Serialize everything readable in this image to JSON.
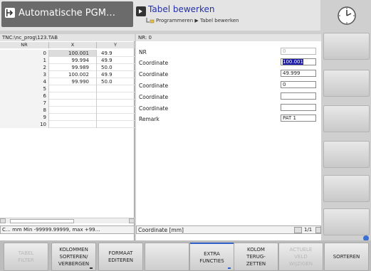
{
  "header": {
    "mode_title": "Automatische PGM…",
    "program_title": "Tabel bewerken",
    "breadcrumb": "Programmeren ▶ Tabel bewerken"
  },
  "table": {
    "path": "TNC:\\nc_prog\\123.TAB",
    "columns": [
      "NR",
      "X",
      "Y"
    ],
    "rows": [
      {
        "nr": "0",
        "x": "100.001",
        "y": "49.9"
      },
      {
        "nr": "1",
        "x": "99.994",
        "y": "49.9"
      },
      {
        "nr": "2",
        "x": "99.989",
        "y": "50.0"
      },
      {
        "nr": "3",
        "x": "100.002",
        "y": "49.9"
      },
      {
        "nr": "4",
        "x": "99.990",
        "y": "50.0"
      },
      {
        "nr": "5",
        "x": "",
        "y": ""
      },
      {
        "nr": "6",
        "x": "",
        "y": ""
      },
      {
        "nr": "7",
        "x": "",
        "y": ""
      },
      {
        "nr": "8",
        "x": "",
        "y": ""
      },
      {
        "nr": "9",
        "x": "",
        "y": ""
      },
      {
        "nr": "10",
        "x": "",
        "y": ""
      }
    ],
    "status": "C… mm Min -99999.99999, max +99…"
  },
  "form": {
    "nr_header": "NR: 0",
    "fields": [
      {
        "label": "NR",
        "value": "0"
      },
      {
        "label": "Coordinate",
        "value": "100.001"
      },
      {
        "label": "Coordinate",
        "value": "49.999"
      },
      {
        "label": "Coordinate",
        "value": "0"
      },
      {
        "label": "Coordinate",
        "value": ""
      },
      {
        "label": "Coordinate",
        "value": ""
      },
      {
        "label": "Remark",
        "value": "PAT 1"
      }
    ],
    "status": "Coordinate [mm]",
    "page": "1/1"
  },
  "softkeys": [
    {
      "label": "TABEL\nFILTER",
      "enabled": false
    },
    {
      "label": "KOLOMMEN\nSORTEREN/\nVERBERGEN",
      "enabled": true
    },
    {
      "label": "FORMAAT\nEDITEREN",
      "enabled": true
    },
    {
      "label": "",
      "enabled": true
    },
    {
      "label": "EXTRA\nFUNCTIES",
      "enabled": true
    },
    {
      "label": "KOLOM\nTERUG-\nZETTEN",
      "enabled": true
    },
    {
      "label": "ACTUELE\nVELD\nWIJZIGEN",
      "enabled": false
    },
    {
      "label": "SORTEREN",
      "enabled": true
    }
  ]
}
